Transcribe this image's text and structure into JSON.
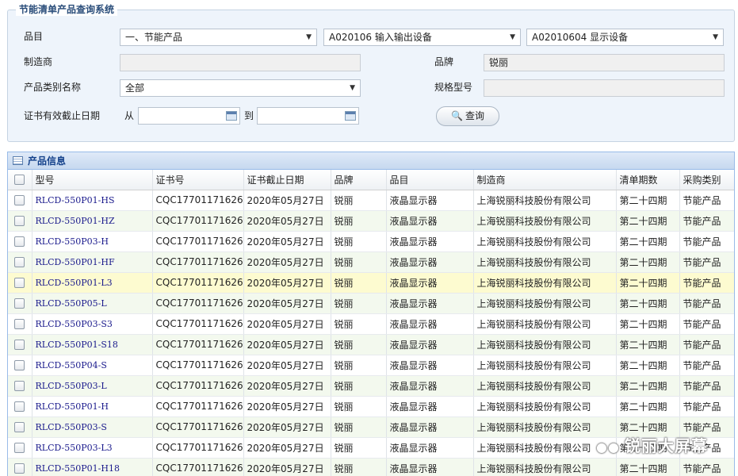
{
  "search": {
    "legend": "节能清单产品查询系统",
    "category_label": "品目",
    "category_1": "一、节能产品",
    "category_2": "A020106 输入输出设备",
    "category_3": "A02010604 显示设备",
    "manufacturer_label": "制造商",
    "manufacturer_value": "",
    "brand_label": "品牌",
    "brand_value": "锐丽",
    "product_type_label": "产品类别名称",
    "product_type_value": "全部",
    "spec_label": "规格型号",
    "spec_value": "",
    "cert_date_label": "证书有效截止日期",
    "from_label": "从",
    "to_label": "到",
    "query_button": "查询"
  },
  "grid": {
    "title": "产品信息",
    "columns": [
      "型号",
      "证书号",
      "证书截止日期",
      "品牌",
      "品目",
      "制造商",
      "清单期数",
      "采购类别"
    ],
    "rows": [
      [
        "RLCD-550P01-HS",
        "CQC17701171626",
        "2020年05月27日",
        "锐丽",
        "液晶显示器",
        "上海锐丽科技股份有限公司",
        "第二十四期",
        "节能产品"
      ],
      [
        "RLCD-550P01-HZ",
        "CQC17701171626",
        "2020年05月27日",
        "锐丽",
        "液晶显示器",
        "上海锐丽科技股份有限公司",
        "第二十四期",
        "节能产品"
      ],
      [
        "RLCD-550P03-H",
        "CQC17701171626",
        "2020年05月27日",
        "锐丽",
        "液晶显示器",
        "上海锐丽科技股份有限公司",
        "第二十四期",
        "节能产品"
      ],
      [
        "RLCD-550P01-HF",
        "CQC17701171626",
        "2020年05月27日",
        "锐丽",
        "液晶显示器",
        "上海锐丽科技股份有限公司",
        "第二十四期",
        "节能产品"
      ],
      [
        "RLCD-550P01-L3",
        "CQC17701171626",
        "2020年05月27日",
        "锐丽",
        "液晶显示器",
        "上海锐丽科技股份有限公司",
        "第二十四期",
        "节能产品"
      ],
      [
        "RLCD-550P05-L",
        "CQC17701171626",
        "2020年05月27日",
        "锐丽",
        "液晶显示器",
        "上海锐丽科技股份有限公司",
        "第二十四期",
        "节能产品"
      ],
      [
        "RLCD-550P03-S3",
        "CQC17701171626",
        "2020年05月27日",
        "锐丽",
        "液晶显示器",
        "上海锐丽科技股份有限公司",
        "第二十四期",
        "节能产品"
      ],
      [
        "RLCD-550P01-S18",
        "CQC17701171626",
        "2020年05月27日",
        "锐丽",
        "液晶显示器",
        "上海锐丽科技股份有限公司",
        "第二十四期",
        "节能产品"
      ],
      [
        "RLCD-550P04-S",
        "CQC17701171626",
        "2020年05月27日",
        "锐丽",
        "液晶显示器",
        "上海锐丽科技股份有限公司",
        "第二十四期",
        "节能产品"
      ],
      [
        "RLCD-550P03-L",
        "CQC17701171626",
        "2020年05月27日",
        "锐丽",
        "液晶显示器",
        "上海锐丽科技股份有限公司",
        "第二十四期",
        "节能产品"
      ],
      [
        "RLCD-550P01-H",
        "CQC17701171626",
        "2020年05月27日",
        "锐丽",
        "液晶显示器",
        "上海锐丽科技股份有限公司",
        "第二十四期",
        "节能产品"
      ],
      [
        "RLCD-550P03-S",
        "CQC17701171626",
        "2020年05月27日",
        "锐丽",
        "液晶显示器",
        "上海锐丽科技股份有限公司",
        "第二十四期",
        "节能产品"
      ],
      [
        "RLCD-550P03-L3",
        "CQC17701171626",
        "2020年05月27日",
        "锐丽",
        "液晶显示器",
        "上海锐丽科技股份有限公司",
        "第二十四期",
        "节能产品"
      ],
      [
        "RLCD-550P01-H18",
        "CQC17701171626",
        "2020年05月27日",
        "锐丽",
        "液晶显示器",
        "上海锐丽科技股份有限公司",
        "第二十四期",
        "节能产品"
      ]
    ],
    "highlighted_row": 4
  },
  "watermark": "锐丽大屏幕"
}
